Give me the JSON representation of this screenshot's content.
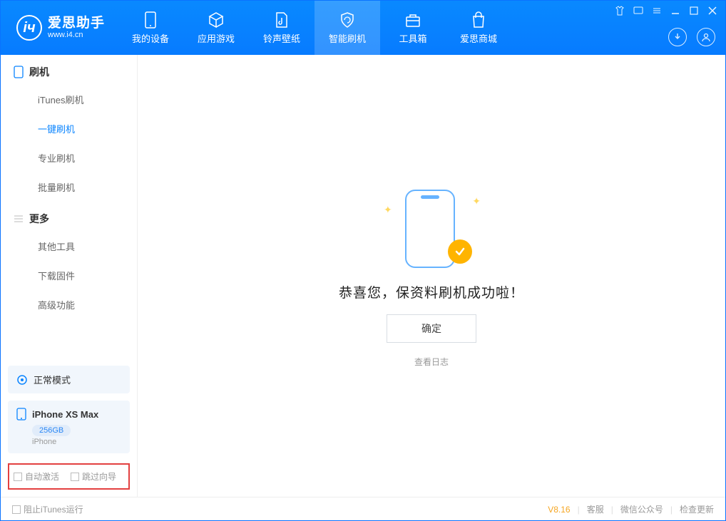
{
  "app": {
    "title": "爱思助手",
    "url": "www.i4.cn"
  },
  "nav": {
    "tabs": [
      {
        "label": "我的设备"
      },
      {
        "label": "应用游戏"
      },
      {
        "label": "铃声壁纸"
      },
      {
        "label": "智能刷机"
      },
      {
        "label": "工具箱"
      },
      {
        "label": "爱思商城"
      }
    ]
  },
  "sidebar": {
    "section1": {
      "title": "刷机",
      "items": [
        "iTunes刷机",
        "一键刷机",
        "专业刷机",
        "批量刷机"
      ]
    },
    "section2": {
      "title": "更多",
      "items": [
        "其他工具",
        "下载固件",
        "高级功能"
      ]
    },
    "mode": "正常模式",
    "device": {
      "name": "iPhone XS Max",
      "capacity": "256GB",
      "type": "iPhone"
    },
    "check1": "自动激活",
    "check2": "跳过向导"
  },
  "main": {
    "success": "恭喜您，保资料刷机成功啦！",
    "ok": "确定",
    "view_log": "查看日志"
  },
  "footer": {
    "block_itunes": "阻止iTunes运行",
    "version": "V8.16",
    "links": [
      "客服",
      "微信公众号",
      "检查更新"
    ]
  }
}
